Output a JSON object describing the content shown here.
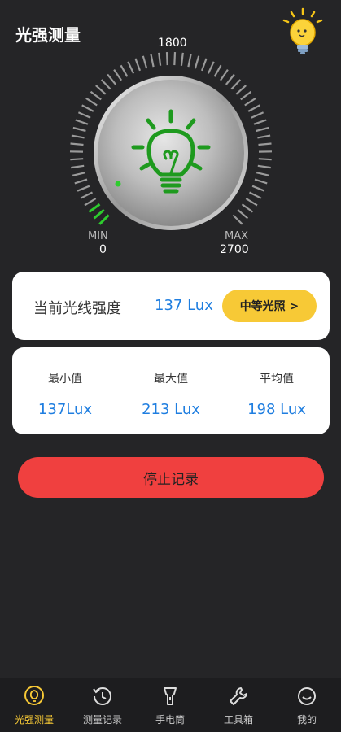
{
  "header": {
    "title": "光强测量"
  },
  "gauge": {
    "top_value": "1800",
    "min_label": "MIN",
    "min_value": "0",
    "max_label": "MAX",
    "max_value": "2700",
    "level_fraction": 0.05,
    "active_color": "#2ecc2e",
    "icon_color": "#1e9a1e"
  },
  "intensity": {
    "label": "当前光线强度",
    "value": "137 Lux",
    "level_button": "中等光照 >"
  },
  "stats": [
    {
      "label": "最小值",
      "value": "137Lux"
    },
    {
      "label": "最大值",
      "value": "213 Lux"
    },
    {
      "label": "平均值",
      "value": "198 Lux"
    }
  ],
  "stop_button": "停止记录",
  "tabbar": {
    "items": [
      {
        "label": "光强测量",
        "icon": "bulb-icon",
        "active": true
      },
      {
        "label": "测量记录",
        "icon": "history-icon",
        "active": false
      },
      {
        "label": "手电筒",
        "icon": "flashlight-icon",
        "active": false
      },
      {
        "label": "工具箱",
        "icon": "wrench-icon",
        "active": false
      },
      {
        "label": "我的",
        "icon": "smile-icon",
        "active": false
      }
    ]
  },
  "colors": {
    "accent": "#f7c936",
    "value_blue": "#1f7ee0",
    "stop_red": "#f0403f",
    "background": "#252527"
  }
}
